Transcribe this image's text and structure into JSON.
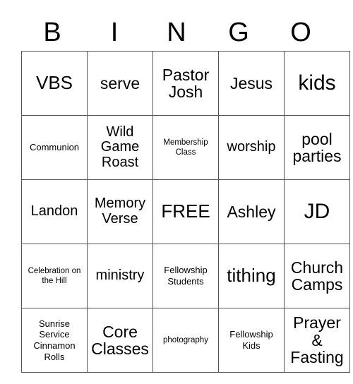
{
  "card": {
    "title": "BINGO",
    "header_letters": [
      "B",
      "I",
      "N",
      "G",
      "O"
    ],
    "free_space_label": "FREE",
    "colors": {
      "background": "#ffffff",
      "text": "#000000",
      "grid_border": "#555555"
    },
    "rows": [
      [
        {
          "text": "VBS",
          "size": "fs-2xl"
        },
        {
          "text": "serve",
          "size": "fs-xl"
        },
        {
          "text": "Pastor Josh",
          "size": "fs-xl"
        },
        {
          "text": "Jesus",
          "size": "fs-xl"
        },
        {
          "text": "kids",
          "size": "fs-3xl"
        }
      ],
      [
        {
          "text": "Communion",
          "size": "fs-sm"
        },
        {
          "text": "Wild Game Roast",
          "size": "fs-lg"
        },
        {
          "text": "Membership Class",
          "size": "fs-xs"
        },
        {
          "text": "worship",
          "size": "fs-lg"
        },
        {
          "text": "pool parties",
          "size": "fs-xl"
        }
      ],
      [
        {
          "text": "Landon",
          "size": "fs-lg"
        },
        {
          "text": "Memory Verse",
          "size": "fs-lg"
        },
        {
          "text": "FREE",
          "size": "fs-2xl"
        },
        {
          "text": "Ashley",
          "size": "fs-xl"
        },
        {
          "text": "JD",
          "size": "fs-3xl"
        }
      ],
      [
        {
          "text": "Celebration on the Hill",
          "size": "fs-xs"
        },
        {
          "text": "ministry",
          "size": "fs-lg"
        },
        {
          "text": "Fellowship Students",
          "size": "fs-sm"
        },
        {
          "text": "tithing",
          "size": "fs-2xl"
        },
        {
          "text": "Church Camps",
          "size": "fs-xl"
        }
      ],
      [
        {
          "text": "Sunrise Service Cinnamon Rolls",
          "size": "fs-sm"
        },
        {
          "text": "Core Classes",
          "size": "fs-xl"
        },
        {
          "text": "photography",
          "size": "fs-xs"
        },
        {
          "text": "Fellowship Kids",
          "size": "fs-sm"
        },
        {
          "text": "Prayer & Fasting",
          "size": "fs-xl"
        }
      ]
    ]
  }
}
